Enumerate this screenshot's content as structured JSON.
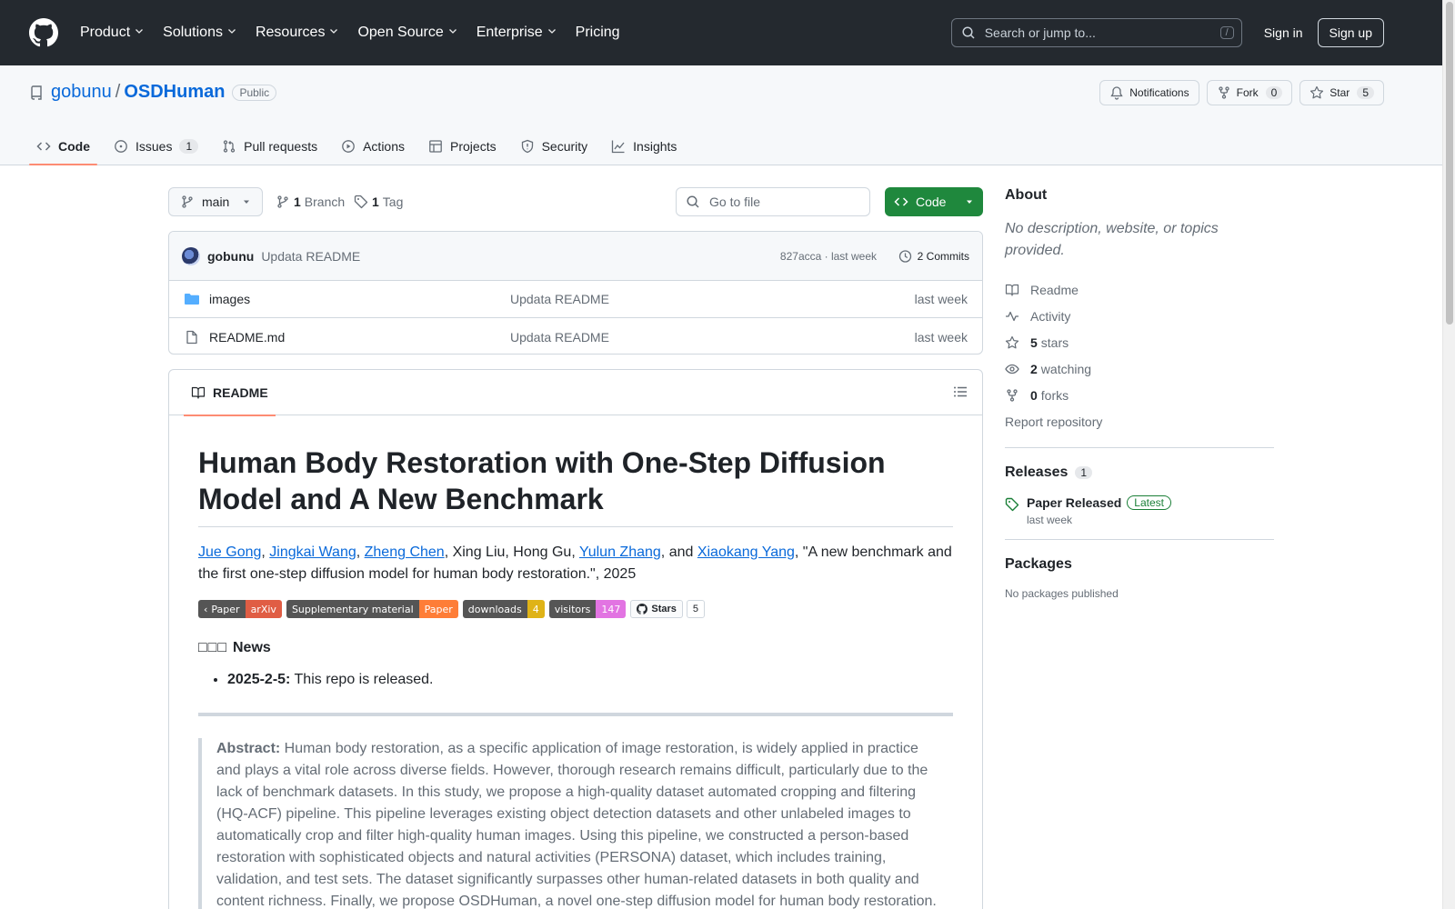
{
  "header": {
    "nav": [
      "Product",
      "Solutions",
      "Resources",
      "Open Source",
      "Enterprise",
      "Pricing"
    ],
    "search_placeholder": "Search or jump to...",
    "search_shortcut": "/",
    "sign_in": "Sign in",
    "sign_up": "Sign up"
  },
  "repo": {
    "owner": "gobunu",
    "separator": "/",
    "name": "OSDHuman",
    "visibility": "Public",
    "notifications_label": "Notifications",
    "fork_label": "Fork",
    "fork_count": "0",
    "star_label": "Star",
    "star_count": "5"
  },
  "tabs": {
    "code": "Code",
    "issues": "Issues",
    "issues_count": "1",
    "pulls": "Pull requests",
    "actions": "Actions",
    "projects": "Projects",
    "security": "Security",
    "insights": "Insights"
  },
  "file_nav": {
    "branch": "main",
    "branch_count": "1",
    "branch_label": "Branch",
    "tag_count": "1",
    "tag_label": "Tag",
    "goto_placeholder": "Go to file",
    "code_button": "Code"
  },
  "commit": {
    "author": "gobunu",
    "message": "Updata README",
    "sha": "827acca",
    "time": "· last week",
    "commits_label": "2 Commits"
  },
  "files": [
    {
      "name": "images",
      "message": "Updata README",
      "time": "last week"
    },
    {
      "name": "README.md",
      "message": "Updata README",
      "time": "last week"
    }
  ],
  "readme": {
    "tab_label": "README",
    "title": "Human Body Restoration with One-Step Diffusion Model and A New Benchmark",
    "authors": {
      "a1": "Jue Gong",
      "s1": ", ",
      "a2": "Jingkai Wang",
      "s2": ", ",
      "a3": "Zheng Chen",
      "s3": ", Xing Liu, Hong Gu, ",
      "a4": "Yulun Zhang",
      "s4": ", and ",
      "a5": "Xiaokang Yang",
      "tail": ", \"A new benchmark and the first one-step diffusion model for human body restoration.\", 2025"
    },
    "badges": [
      {
        "left": "Paper",
        "right": "arXiv",
        "color": "#e05d44"
      },
      {
        "left": "Supplementary material",
        "right": "Paper",
        "color": "#fe7d37"
      },
      {
        "left": "downloads",
        "right": "4",
        "color": "#dfb317"
      },
      {
        "left": "visitors",
        "right": "147",
        "color": "#e274e2"
      }
    ],
    "gh_stars_label": "Stars",
    "gh_stars_count": "5",
    "news_boxes": "□□□",
    "news_title": "News",
    "news_date": "2025-2-5:",
    "news_text": " This repo is released.",
    "abstract_label": "Abstract:",
    "abstract_text": " Human body restoration, as a specific application of image restoration, is widely applied in practice and plays a vital role across diverse fields. However, thorough research remains difficult, particularly due to the lack of benchmark datasets. In this study, we propose a high-quality dataset automated cropping and filtering (HQ-ACF) pipeline. This pipeline leverages existing object detection datasets and other unlabeled images to automatically crop and filter high-quality human images. Using this pipeline, we constructed a person-based restoration with sophisticated objects and natural activities (PERSONA) dataset, which includes training, validation, and test sets. The dataset significantly surpasses other human-related datasets in both quality and content richness. Finally, we propose OSDHuman, a novel one-step diffusion model for human body restoration."
  },
  "sidebar": {
    "about_title": "About",
    "about_desc": "No description, website, or topics provided.",
    "readme": "Readme",
    "activity": "Activity",
    "stars_count": "5",
    "stars_label": "stars",
    "watching_count": "2",
    "watching_label": "watching",
    "forks_count": "0",
    "forks_label": "forks",
    "report": "Report repository",
    "releases_title": "Releases",
    "releases_count": "1",
    "release_name": "Paper Released",
    "release_latest": "Latest",
    "release_time": "last week",
    "packages_title": "Packages",
    "packages_text": "No packages published"
  }
}
